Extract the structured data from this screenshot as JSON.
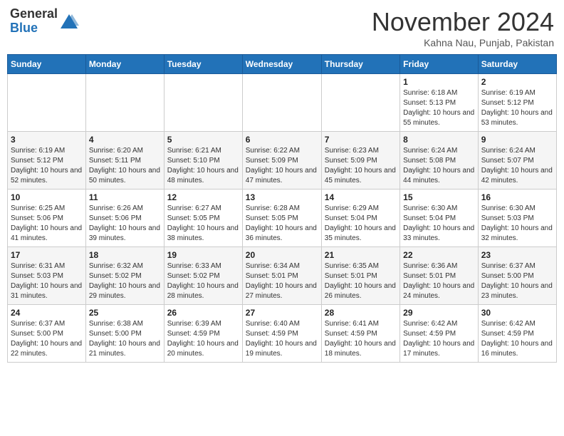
{
  "header": {
    "logo_general": "General",
    "logo_blue": "Blue",
    "month_title": "November 2024",
    "location": "Kahna Nau, Punjab, Pakistan"
  },
  "days_of_week": [
    "Sunday",
    "Monday",
    "Tuesday",
    "Wednesday",
    "Thursday",
    "Friday",
    "Saturday"
  ],
  "weeks": [
    [
      {
        "day": "",
        "sunrise": "",
        "sunset": "",
        "daylight": ""
      },
      {
        "day": "",
        "sunrise": "",
        "sunset": "",
        "daylight": ""
      },
      {
        "day": "",
        "sunrise": "",
        "sunset": "",
        "daylight": ""
      },
      {
        "day": "",
        "sunrise": "",
        "sunset": "",
        "daylight": ""
      },
      {
        "day": "",
        "sunrise": "",
        "sunset": "",
        "daylight": ""
      },
      {
        "day": "1",
        "sunrise": "Sunrise: 6:18 AM",
        "sunset": "Sunset: 5:13 PM",
        "daylight": "Daylight: 10 hours and 55 minutes."
      },
      {
        "day": "2",
        "sunrise": "Sunrise: 6:19 AM",
        "sunset": "Sunset: 5:12 PM",
        "daylight": "Daylight: 10 hours and 53 minutes."
      }
    ],
    [
      {
        "day": "3",
        "sunrise": "Sunrise: 6:19 AM",
        "sunset": "Sunset: 5:12 PM",
        "daylight": "Daylight: 10 hours and 52 minutes."
      },
      {
        "day": "4",
        "sunrise": "Sunrise: 6:20 AM",
        "sunset": "Sunset: 5:11 PM",
        "daylight": "Daylight: 10 hours and 50 minutes."
      },
      {
        "day": "5",
        "sunrise": "Sunrise: 6:21 AM",
        "sunset": "Sunset: 5:10 PM",
        "daylight": "Daylight: 10 hours and 48 minutes."
      },
      {
        "day": "6",
        "sunrise": "Sunrise: 6:22 AM",
        "sunset": "Sunset: 5:09 PM",
        "daylight": "Daylight: 10 hours and 47 minutes."
      },
      {
        "day": "7",
        "sunrise": "Sunrise: 6:23 AM",
        "sunset": "Sunset: 5:09 PM",
        "daylight": "Daylight: 10 hours and 45 minutes."
      },
      {
        "day": "8",
        "sunrise": "Sunrise: 6:24 AM",
        "sunset": "Sunset: 5:08 PM",
        "daylight": "Daylight: 10 hours and 44 minutes."
      },
      {
        "day": "9",
        "sunrise": "Sunrise: 6:24 AM",
        "sunset": "Sunset: 5:07 PM",
        "daylight": "Daylight: 10 hours and 42 minutes."
      }
    ],
    [
      {
        "day": "10",
        "sunrise": "Sunrise: 6:25 AM",
        "sunset": "Sunset: 5:06 PM",
        "daylight": "Daylight: 10 hours and 41 minutes."
      },
      {
        "day": "11",
        "sunrise": "Sunrise: 6:26 AM",
        "sunset": "Sunset: 5:06 PM",
        "daylight": "Daylight: 10 hours and 39 minutes."
      },
      {
        "day": "12",
        "sunrise": "Sunrise: 6:27 AM",
        "sunset": "Sunset: 5:05 PM",
        "daylight": "Daylight: 10 hours and 38 minutes."
      },
      {
        "day": "13",
        "sunrise": "Sunrise: 6:28 AM",
        "sunset": "Sunset: 5:05 PM",
        "daylight": "Daylight: 10 hours and 36 minutes."
      },
      {
        "day": "14",
        "sunrise": "Sunrise: 6:29 AM",
        "sunset": "Sunset: 5:04 PM",
        "daylight": "Daylight: 10 hours and 35 minutes."
      },
      {
        "day": "15",
        "sunrise": "Sunrise: 6:30 AM",
        "sunset": "Sunset: 5:04 PM",
        "daylight": "Daylight: 10 hours and 33 minutes."
      },
      {
        "day": "16",
        "sunrise": "Sunrise: 6:30 AM",
        "sunset": "Sunset: 5:03 PM",
        "daylight": "Daylight: 10 hours and 32 minutes."
      }
    ],
    [
      {
        "day": "17",
        "sunrise": "Sunrise: 6:31 AM",
        "sunset": "Sunset: 5:03 PM",
        "daylight": "Daylight: 10 hours and 31 minutes."
      },
      {
        "day": "18",
        "sunrise": "Sunrise: 6:32 AM",
        "sunset": "Sunset: 5:02 PM",
        "daylight": "Daylight: 10 hours and 29 minutes."
      },
      {
        "day": "19",
        "sunrise": "Sunrise: 6:33 AM",
        "sunset": "Sunset: 5:02 PM",
        "daylight": "Daylight: 10 hours and 28 minutes."
      },
      {
        "day": "20",
        "sunrise": "Sunrise: 6:34 AM",
        "sunset": "Sunset: 5:01 PM",
        "daylight": "Daylight: 10 hours and 27 minutes."
      },
      {
        "day": "21",
        "sunrise": "Sunrise: 6:35 AM",
        "sunset": "Sunset: 5:01 PM",
        "daylight": "Daylight: 10 hours and 26 minutes."
      },
      {
        "day": "22",
        "sunrise": "Sunrise: 6:36 AM",
        "sunset": "Sunset: 5:01 PM",
        "daylight": "Daylight: 10 hours and 24 minutes."
      },
      {
        "day": "23",
        "sunrise": "Sunrise: 6:37 AM",
        "sunset": "Sunset: 5:00 PM",
        "daylight": "Daylight: 10 hours and 23 minutes."
      }
    ],
    [
      {
        "day": "24",
        "sunrise": "Sunrise: 6:37 AM",
        "sunset": "Sunset: 5:00 PM",
        "daylight": "Daylight: 10 hours and 22 minutes."
      },
      {
        "day": "25",
        "sunrise": "Sunrise: 6:38 AM",
        "sunset": "Sunset: 5:00 PM",
        "daylight": "Daylight: 10 hours and 21 minutes."
      },
      {
        "day": "26",
        "sunrise": "Sunrise: 6:39 AM",
        "sunset": "Sunset: 4:59 PM",
        "daylight": "Daylight: 10 hours and 20 minutes."
      },
      {
        "day": "27",
        "sunrise": "Sunrise: 6:40 AM",
        "sunset": "Sunset: 4:59 PM",
        "daylight": "Daylight: 10 hours and 19 minutes."
      },
      {
        "day": "28",
        "sunrise": "Sunrise: 6:41 AM",
        "sunset": "Sunset: 4:59 PM",
        "daylight": "Daylight: 10 hours and 18 minutes."
      },
      {
        "day": "29",
        "sunrise": "Sunrise: 6:42 AM",
        "sunset": "Sunset: 4:59 PM",
        "daylight": "Daylight: 10 hours and 17 minutes."
      },
      {
        "day": "30",
        "sunrise": "Sunrise: 6:42 AM",
        "sunset": "Sunset: 4:59 PM",
        "daylight": "Daylight: 10 hours and 16 minutes."
      }
    ]
  ]
}
